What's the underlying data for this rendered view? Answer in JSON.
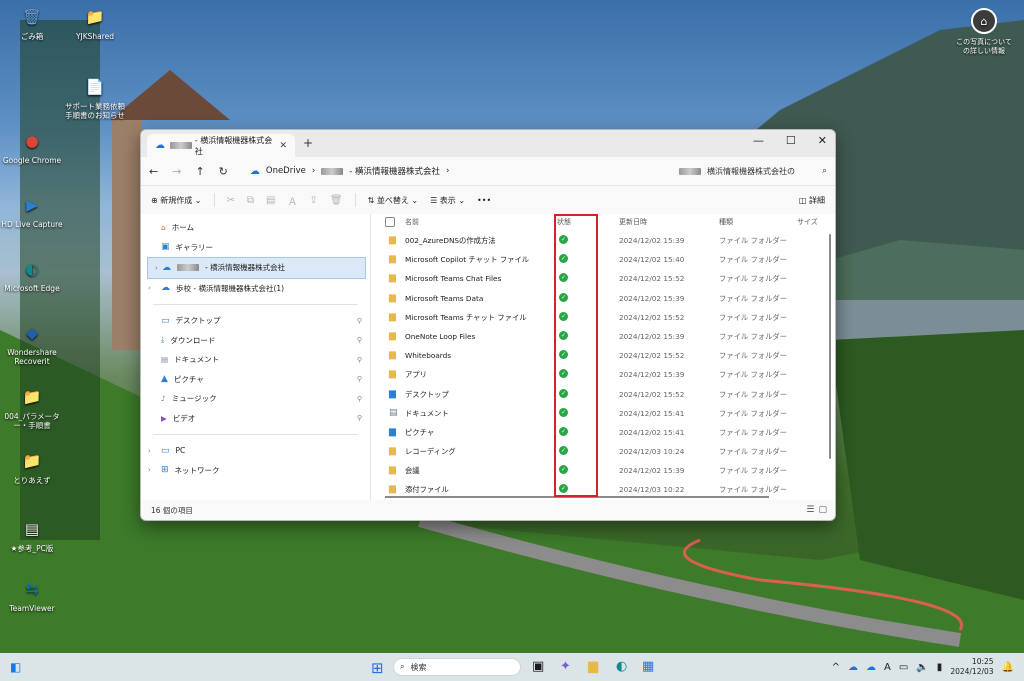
{
  "desktop": {
    "icons": [
      {
        "label": "ごみ箱",
        "glyph": "🗑",
        "color": "#6aa6df"
      },
      {
        "label": "YJKShared",
        "glyph": "📁",
        "color": "#e8b94a"
      },
      {
        "label": "サポート業務依頼手順書のお知らせ",
        "glyph": "📄",
        "color": "#ffffff"
      },
      {
        "label": "Google Chrome",
        "glyph": "●",
        "color": "#db4437"
      },
      {
        "label": "HD Live Capture",
        "glyph": "▶",
        "color": "#2d7fd4"
      },
      {
        "label": "Microsoft Edge",
        "glyph": "◐",
        "color": "#0f8b8d"
      },
      {
        "label": "Wondershare Recoverit",
        "glyph": "◆",
        "color": "#1f5fb0"
      },
      {
        "label": "004_パラメーター・手順書",
        "glyph": "📁",
        "color": "#e8b94a"
      },
      {
        "label": "とりあえず",
        "glyph": "📁",
        "color": "#e8b94a"
      },
      {
        "label": "★参考_PC版",
        "glyph": "▤",
        "color": "#f0f0f0"
      },
      {
        "label": "TeamViewer",
        "glyph": "⇆",
        "color": "#0e6fd8"
      }
    ],
    "photo_info": "この写真についての詳しい情報"
  },
  "explorer": {
    "tab_title": "- 横浜情報機器株式会社",
    "address": {
      "root": "OneDrive",
      "folder": "- 横浜情報機器株式会社"
    },
    "search_placeholder": "横浜情報機器株式会社の",
    "toolbar": {
      "new": "新規作成",
      "sort": "並べ替え",
      "view": "表示",
      "more": "•••",
      "details": "詳細"
    },
    "nav": {
      "home": "ホーム",
      "gallery": "ギャラリー",
      "onedrive_selected": "- 横浜情報機器株式会社",
      "onedrive_other": "歩校 - 横浜情報機器株式会社(1)",
      "quick": [
        "デスクトップ",
        "ダウンロード",
        "ドキュメント",
        "ピクチャ",
        "ミュージック",
        "ビデオ"
      ],
      "pc": "PC",
      "network": "ネットワーク"
    },
    "columns": {
      "name": "名前",
      "status": "状態",
      "date": "更新日時",
      "type": "種類",
      "size": "サイズ"
    },
    "files": [
      {
        "name": "002_AzureDNSの作成方法",
        "date": "2024/12/02 15:39",
        "type": "ファイル フォルダー",
        "icon": "folder"
      },
      {
        "name": "Microsoft Copilot チャット ファイル",
        "date": "2024/12/02 15:40",
        "type": "ファイル フォルダー",
        "icon": "folder"
      },
      {
        "name": "Microsoft Teams Chat Files",
        "date": "2024/12/02 15:52",
        "type": "ファイル フォルダー",
        "icon": "folder"
      },
      {
        "name": "Microsoft Teams Data",
        "date": "2024/12/02 15:39",
        "type": "ファイル フォルダー",
        "icon": "folder"
      },
      {
        "name": "Microsoft Teams チャット ファイル",
        "date": "2024/12/02 15:52",
        "type": "ファイル フォルダー",
        "icon": "folder"
      },
      {
        "name": "OneNote Loop Files",
        "date": "2024/12/02 15:39",
        "type": "ファイル フォルダー",
        "icon": "folder"
      },
      {
        "name": "Whiteboards",
        "date": "2024/12/02 15:52",
        "type": "ファイル フォルダー",
        "icon": "folder"
      },
      {
        "name": "アプリ",
        "date": "2024/12/02 15:39",
        "type": "ファイル フォルダー",
        "icon": "folder"
      },
      {
        "name": "デスクトップ",
        "date": "2024/12/02 15:52",
        "type": "ファイル フォルダー",
        "icon": "blue"
      },
      {
        "name": "ドキュメント",
        "date": "2024/12/02 15:41",
        "type": "ファイル フォルダー",
        "icon": "doc"
      },
      {
        "name": "ピクチャ",
        "date": "2024/12/02 15:41",
        "type": "ファイル フォルダー",
        "icon": "blue"
      },
      {
        "name": "レコーディング",
        "date": "2024/12/03 10:24",
        "type": "ファイル フォルダー",
        "icon": "folder"
      },
      {
        "name": "会議",
        "date": "2024/12/02 15:39",
        "type": "ファイル フォルダー",
        "icon": "folder"
      },
      {
        "name": "添付ファイル",
        "date": "2024/12/03 10:22",
        "type": "ファイル フォルダー",
        "icon": "folder"
      }
    ],
    "status_text": "16 個の項目"
  },
  "taskbar": {
    "search_placeholder": "検索",
    "time": "10:25",
    "date": "2024/12/03",
    "ime": "A"
  },
  "colors": {
    "highlight": "#d2232a",
    "synced": "#26a645",
    "accent": "#1a73e8"
  }
}
